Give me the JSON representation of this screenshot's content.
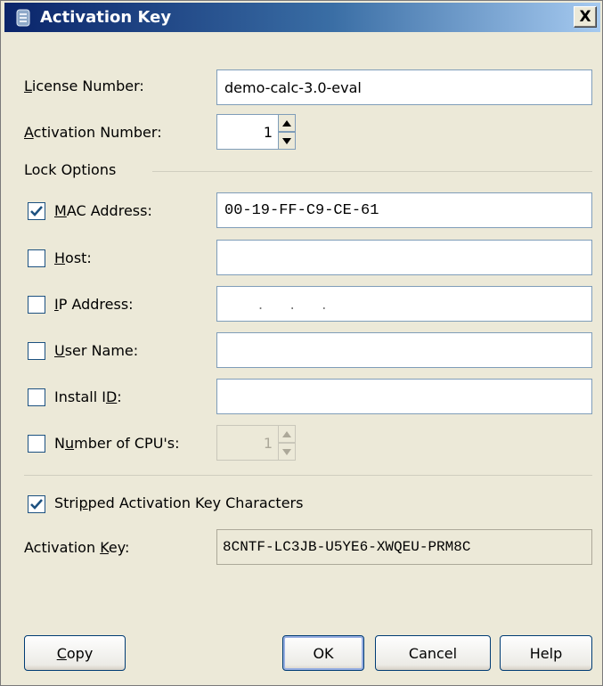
{
  "window": {
    "title": "Activation Key",
    "close_symbol": "X",
    "icon": "app-key-icon"
  },
  "license": {
    "label_prefix": "",
    "label_mnemonic": "L",
    "label_rest": "icense Number:",
    "value": "demo-calc-3.0-eval"
  },
  "activation_number": {
    "label_mnemonic": "A",
    "label_rest": "ctivation Number:",
    "value": "1"
  },
  "lock_options": {
    "section_label": "Lock Options",
    "mac": {
      "checked": true,
      "label_mnemonic": "M",
      "label_rest": "AC Address:",
      "value": "00-19-FF-C9-CE-61"
    },
    "host": {
      "checked": false,
      "label_mnemonic": "H",
      "label_rest": "ost:",
      "value": ""
    },
    "ip": {
      "checked": false,
      "label_mnemonic": "I",
      "label_rest": "P Address:",
      "value": ".      .      ."
    },
    "user": {
      "checked": false,
      "label_mnemonic": "U",
      "label_rest": "ser Name:",
      "value": ""
    },
    "install_id": {
      "checked": false,
      "label_before": "Install I",
      "label_mnemonic": "D",
      "label_rest": ":",
      "value": ""
    },
    "cpus": {
      "checked": false,
      "label_before": "N",
      "label_mnemonic": "u",
      "label_rest": "mber of CPU's:",
      "value": "1"
    }
  },
  "stripped": {
    "checked": true,
    "label_before": "Stri",
    "label_mnemonic": "p",
    "label_rest": "ped Activation Key Characters"
  },
  "activation_key": {
    "label_before": "Activation ",
    "label_mnemonic": "K",
    "label_rest": "ey:",
    "value": "8CNTF-LC3JB-U5YE6-XWQEU-PRM8C"
  },
  "buttons": {
    "copy_mnemonic": "C",
    "copy_rest": "opy",
    "ok": "OK",
    "cancel": "Cancel",
    "help": "Help"
  },
  "colors": {
    "title_gradient_start": "#0a246a",
    "check_color": "#1c5180"
  }
}
